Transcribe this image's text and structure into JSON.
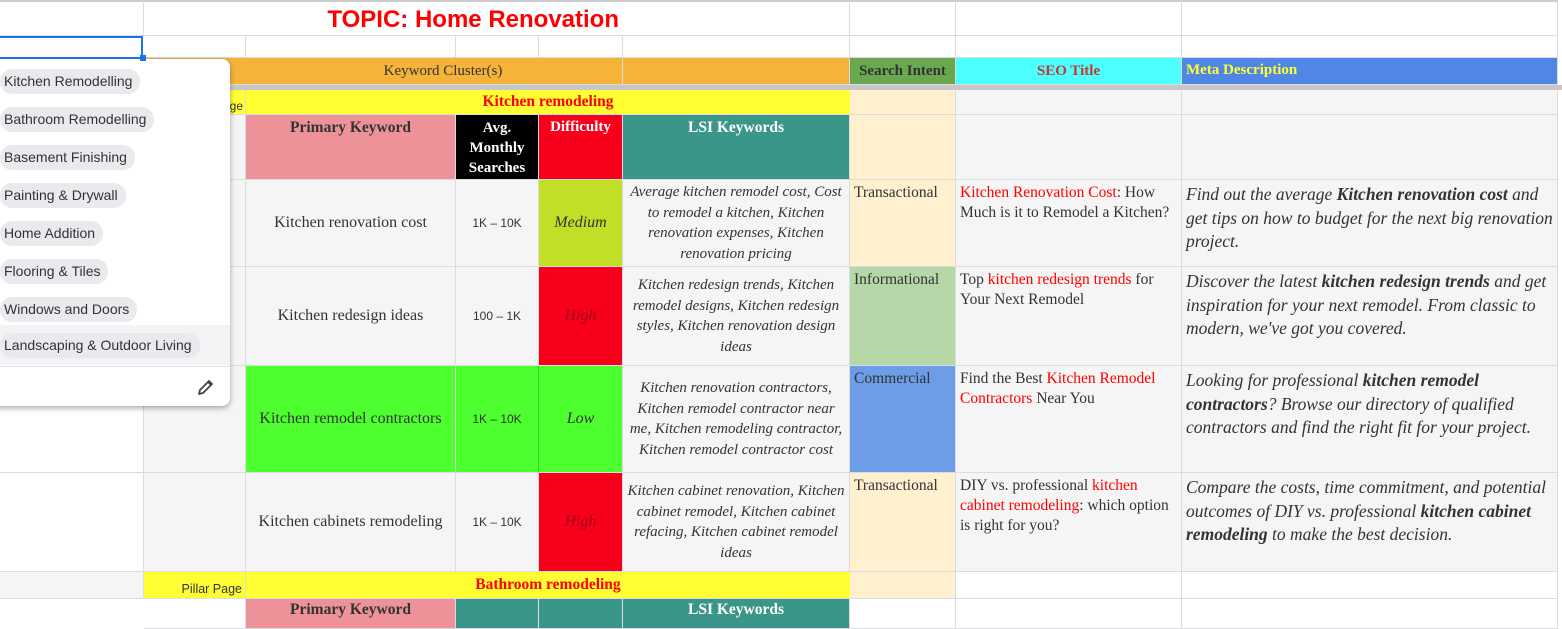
{
  "sheet": {
    "topic_title": "TOPIC: Home Renovation",
    "headers": {
      "keyword_cluster": "Keyword Cluster(s)",
      "search_intent": "Search Intent",
      "seo_title": "SEO Title",
      "meta_description": "Meta Description"
    },
    "colors": {
      "header_orange": "#f6b33a",
      "search_intent_green": "#6aa84f",
      "seo_title_cyan": "#4dffff",
      "meta_blue": "#5087e6",
      "pillar_yellow": "#ffff33",
      "primary_kw_pink": "#ec9298",
      "lsi_teal": "#3a9688",
      "difficulty_medium": "#c2df27",
      "difficulty_high": "#f8001c",
      "difficulty_low": "#4dff2e",
      "intent_transactional": "#fff0cf",
      "intent_informational": "#b6d7a8",
      "intent_commercial": "#6c9de6",
      "keyword_red": "#ff0000"
    },
    "pillar_label": "Pillar Page",
    "pillar_label_partial": "ge",
    "cluster_columns": {
      "primary_keyword": "Primary Keyword",
      "avg_monthly_searches": "Avg. Monthly Searches",
      "difficulty": "Difficulty",
      "lsi_keywords": "LSI Keywords"
    },
    "clusters": [
      {
        "pillar": "Kitchen remodeling",
        "rows": [
          {
            "primary_keyword": "Kitchen renovation cost",
            "avg_monthly_searches": "1K – 10K",
            "difficulty": "Medium",
            "lsi_keywords": "Average kitchen remodel cost, Cost to remodel a kitchen, Kitchen renovation expenses, Kitchen renovation pricing",
            "search_intent": "Transactional",
            "seo_title": {
              "pre": "",
              "highlight": "Kitchen Renovation Cost",
              "post": ": How Much is it to Remodel a Kitchen?"
            },
            "meta": {
              "pre": "Find out the average ",
              "bold": "Kitchen renovation cost",
              "post": " and get tips on how to budget for the next big renovation project."
            }
          },
          {
            "primary_keyword": "Kitchen redesign ideas",
            "avg_monthly_searches": "100 – 1K",
            "difficulty": "High",
            "lsi_keywords": "Kitchen redesign trends, Kitchen remodel designs, Kitchen redesign styles, Kitchen renovation design ideas",
            "search_intent": "Informational",
            "seo_title": {
              "pre": "Top ",
              "highlight": "kitchen redesign trends",
              "post": " for Your Next Remodel"
            },
            "meta": {
              "pre": "Discover the latest ",
              "bold": "kitchen redesign trends",
              "post": " and get inspiration for your next remodel. From classic to modern, we've got you covered."
            }
          },
          {
            "primary_keyword": "Kitchen remodel contractors",
            "avg_monthly_searches": "1K – 10K",
            "difficulty": "Low",
            "lsi_keywords": "Kitchen renovation contractors, Kitchen remodel contractor near me, Kitchen remodeling contractor, Kitchen remodel contractor cost",
            "search_intent": "Commercial",
            "seo_title": {
              "pre": "Find the Best ",
              "highlight": "Kitchen Remodel Contractors",
              "post": " Near You"
            },
            "meta": {
              "pre": "Looking for professional ",
              "bold": "kitchen remodel contractors",
              "post": "? Browse our directory of qualified contractors and find the right fit for your project."
            }
          },
          {
            "primary_keyword": "Kitchen cabinets remodeling",
            "avg_monthly_searches": "1K – 10K",
            "difficulty": "High",
            "lsi_keywords": "Kitchen cabinet renovation, Kitchen cabinet remodel, Kitchen cabinet refacing, Kitchen cabinet remodel ideas",
            "search_intent": "Transactional",
            "seo_title": {
              "pre": "DIY vs. professional ",
              "highlight": "kitchen cabinet remodeling",
              "post": ": which option is right for you?"
            },
            "meta": {
              "pre": "Compare the costs, time commitment, and potential outcomes of DIY vs. professional ",
              "bold": "kitchen cabinet remodeling",
              "post": " to make the best decision."
            }
          }
        ]
      },
      {
        "pillar": "Bathroom remodeling",
        "header_partial": {
          "primary_keyword": "Primary Keyword",
          "lsi_keywords": "LSI Keywords"
        }
      }
    ]
  },
  "dropdown": {
    "options": [
      "Kitchen Remodelling",
      "Bathroom Remodelling",
      "Basement Finishing",
      "Painting & Drywall",
      "Home Addition",
      "Flooring & Tiles",
      "Windows and Doors",
      "Landscaping & Outdoor Living"
    ],
    "hovered_index": 7,
    "edit_icon": "pencil-icon"
  }
}
